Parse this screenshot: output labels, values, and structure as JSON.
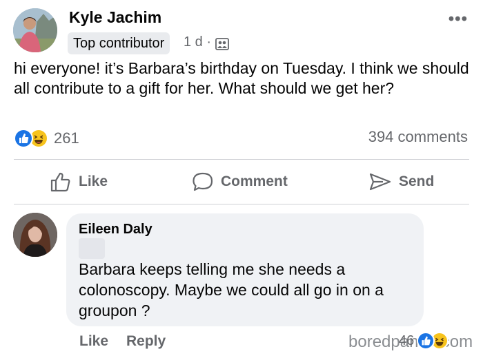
{
  "post": {
    "author": "Kyle Jachim",
    "badge": "Top contributor",
    "time": "1 d",
    "separator": "·",
    "privacy_icon": "group-icon",
    "more_icon": "ellipsis-icon",
    "more_label": "•••",
    "text": "hi everyone! it’s Barbara’s birthday on Tuesday. I think we should all contribute to a gift for her. What should we get her?"
  },
  "reactions": {
    "count": "261",
    "icons": [
      "like-reaction-icon",
      "haha-reaction-icon"
    ],
    "comments": "394 comments"
  },
  "actions": {
    "like": "Like",
    "comment": "Comment",
    "send": "Send"
  },
  "comment": {
    "author": "Eileen Daly",
    "text": "Barbara keeps telling me she needs a colonoscopy. Maybe we could all go in on a groupon ?",
    "like": "Like",
    "reply": "Reply",
    "reaction_count": "46"
  },
  "watermark": "boredpanda.com",
  "colors": {
    "accent": "#1b74e4",
    "haha": "#f7c31d",
    "secondary_text": "#65676b",
    "bubble": "#f0f2f5"
  }
}
